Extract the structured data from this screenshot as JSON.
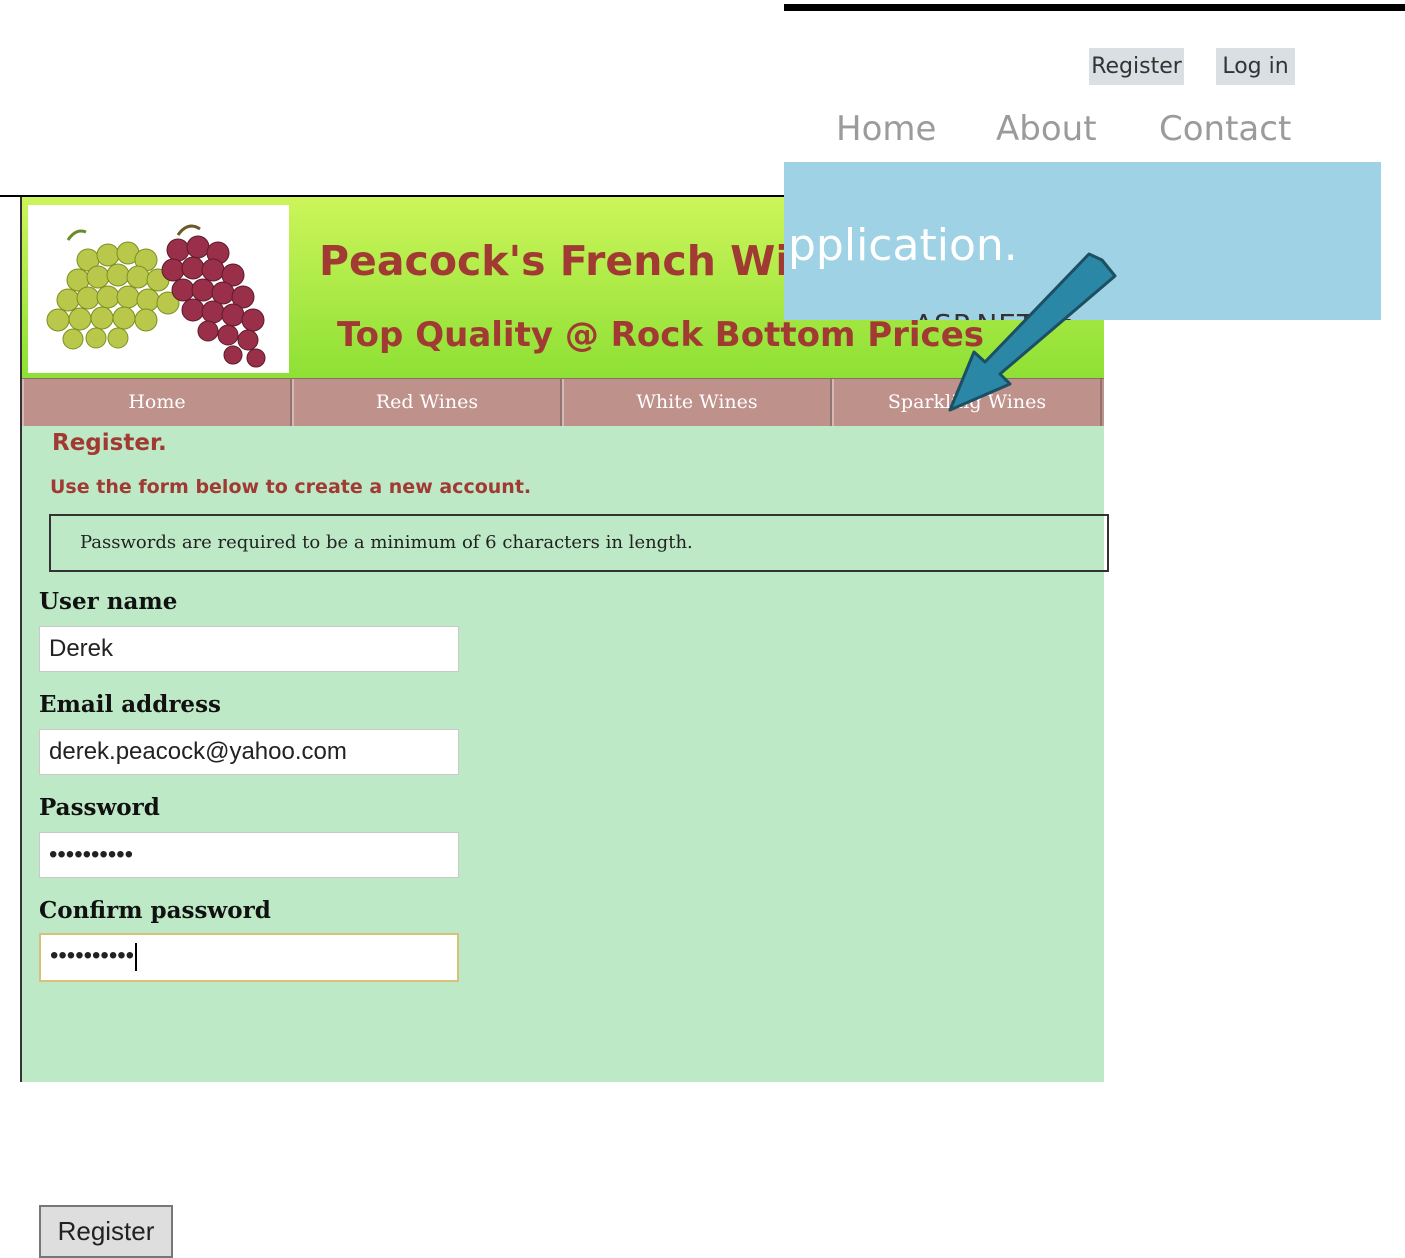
{
  "top_overlay": {
    "register_label": "Register",
    "login_label": "Log in",
    "nav": [
      "Home",
      "About",
      "Contact"
    ],
    "panel_heading": "pplication.",
    "panel_cut_text": "ASP.NET. If"
  },
  "site": {
    "title": "Peacock's French Wine",
    "tagline": "Top Quality @ Rock Bottom Prices",
    "menu": [
      "Home",
      "Red Wines",
      "White Wines",
      "Sparkling Wines"
    ]
  },
  "register": {
    "title": "Register.",
    "subtitle": "Use the form below to create a new account.",
    "notice": "Passwords are required to be a minimum of 6 characters in length.",
    "fields": {
      "username": {
        "label": "User name",
        "value": "Derek"
      },
      "email": {
        "label": "Email address",
        "value": "derek.peacock@yahoo.com"
      },
      "password": {
        "label": "Password",
        "value": "••••••••••"
      },
      "confirm": {
        "label": "Confirm password",
        "value": "••••••••••"
      }
    },
    "submit_label": "Register"
  },
  "colors": {
    "brand_red": "#a13a33",
    "menu_bg": "#bf918b",
    "content_bg": "#bde9c6",
    "overlay_blue": "#9fd2e5",
    "arrow_teal": "#2a87a6"
  }
}
